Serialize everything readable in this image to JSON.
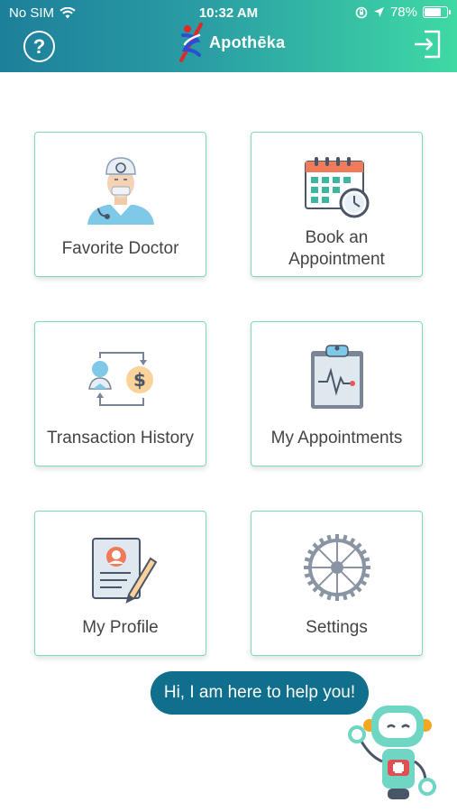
{
  "status_bar": {
    "carrier": "No SIM",
    "time": "10:32 AM",
    "battery_percent": "78%",
    "battery_level": 0.78
  },
  "header": {
    "logo_text": "Apothēka",
    "help_icon_glyph": "?",
    "exit_icon": "logout-icon"
  },
  "tiles": [
    {
      "label": "Favorite Doctor",
      "icon": "doctor-icon"
    },
    {
      "label": "Book an Appointment",
      "icon": "calendar-icon"
    },
    {
      "label": "Transaction History",
      "icon": "transaction-icon"
    },
    {
      "label": "My Appointments",
      "icon": "clipboard-icon"
    },
    {
      "label": "My Profile",
      "icon": "profile-icon"
    },
    {
      "label": "Settings",
      "icon": "gear-icon"
    }
  ],
  "assistant": {
    "message": "Hi, I am here to help you!"
  },
  "colors": {
    "header_start": "#1d7f9a",
    "header_end": "#3fd9a4",
    "tile_border": "#7ed9b8",
    "bubble": "#0f6f8c"
  }
}
